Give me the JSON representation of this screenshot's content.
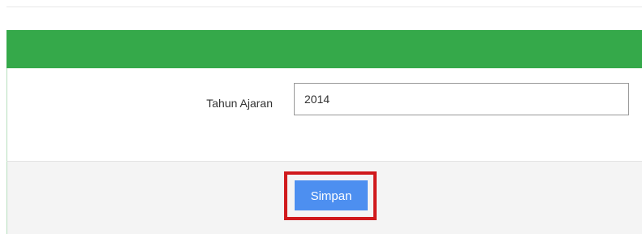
{
  "form": {
    "field_label": "Tahun Ajaran",
    "field_value": "2014",
    "submit_label": "Simpan"
  },
  "colors": {
    "header": "#35a94a",
    "button": "#4d8ff0",
    "highlight": "#d0191c"
  }
}
